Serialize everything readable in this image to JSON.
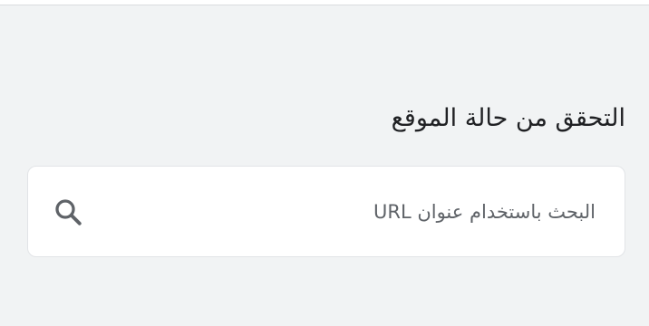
{
  "site_status": {
    "title": "التحقق من حالة الموقع",
    "search": {
      "placeholder": "البحث باستخدام عنوان URL",
      "value": "",
      "icon": "search-icon"
    }
  },
  "colors": {
    "background": "#f1f3f4",
    "card": "#ffffff",
    "title_text": "#202124",
    "placeholder_text": "#5f6368",
    "icon": "#5f6368"
  }
}
